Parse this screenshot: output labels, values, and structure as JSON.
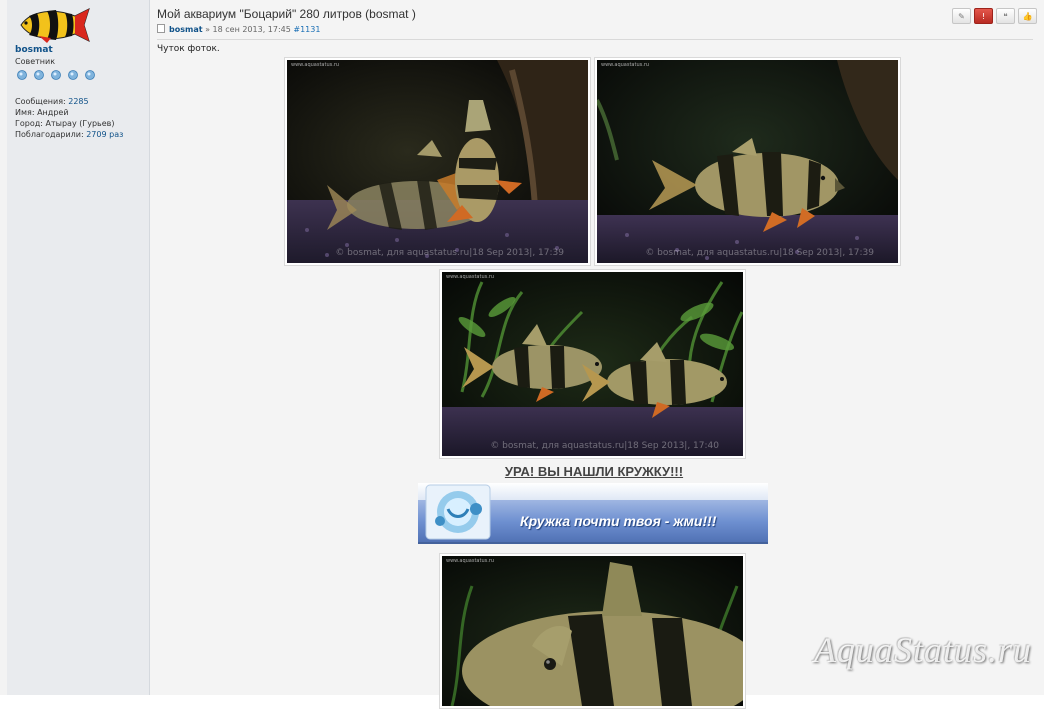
{
  "profile": {
    "username": "bosmat",
    "rank": "Советник",
    "stats": [
      {
        "label": "Сообщения: ",
        "value": "2285"
      },
      {
        "label": "Имя: ",
        "value": "Андрей"
      },
      {
        "label": "Город: ",
        "value": "Атырау (Гурьев)"
      },
      {
        "label": "Поблагодарили: ",
        "value": "2709 раз"
      }
    ]
  },
  "post": {
    "title": "Мой аквариум \"Боцарий\" 280 литров (bosmat )",
    "author": "bosmat",
    "date": " » 18 сен 2013, 17:45 ",
    "number": "#1131",
    "text": "Чуток фоток."
  },
  "buttons": [
    {
      "name": "edit-icon",
      "glyph": "✎"
    },
    {
      "name": "report-icon",
      "glyph": "!"
    },
    {
      "name": "quote-icon",
      "glyph": "❝"
    },
    {
      "name": "thanks-icon",
      "glyph": "👍"
    }
  ],
  "photos": [
    {
      "url": "www.aquastatus.ru",
      "caption": "© bosmat, для aquastatus.ru|18 Sep 2013|, 17:39"
    },
    {
      "url": "www.aquastatus.ru",
      "caption": "© bosmat, для aquastatus.ru|18 Sep 2013|, 17:39"
    },
    {
      "url": "www.aquastatus.ru",
      "caption": "© bosmat, для aquastatus.ru|18 Sep 2013|, 17:40"
    },
    {
      "url": "www.aquastatus.ru",
      "caption": ""
    }
  ],
  "mug": {
    "title": "УРА! ВЫ НАШЛИ КРУЖКУ!!!",
    "banner_text": "Кружка почти твоя - жми!!!"
  },
  "watermark": "AquaStatus.ru",
  "colors": {
    "link": "#105289",
    "report": "#c9342a"
  }
}
